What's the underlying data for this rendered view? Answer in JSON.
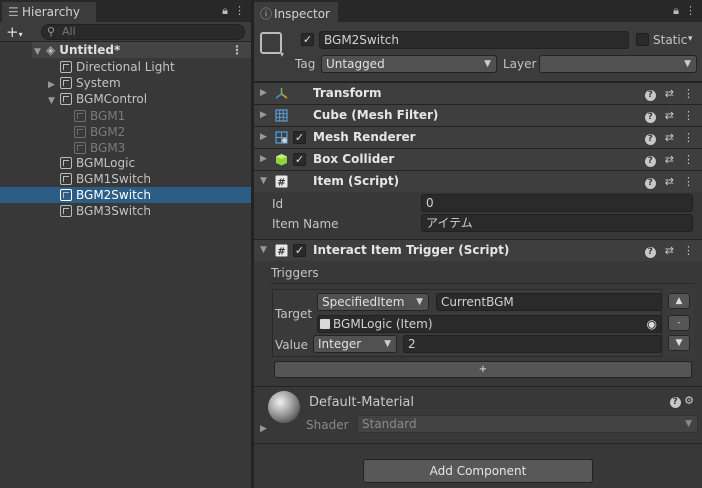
{
  "hierarchy": {
    "tab_title": "Hierarchy",
    "search_placeholder": "All",
    "scene_name": "Untitled*",
    "items": [
      {
        "label": "Directional Light"
      },
      {
        "label": "System"
      },
      {
        "label": "BGMControl"
      },
      {
        "label": "BGM1"
      },
      {
        "label": "BGM2"
      },
      {
        "label": "BGM3"
      },
      {
        "label": "BGMLogic"
      },
      {
        "label": "BGM1Switch"
      },
      {
        "label": "BGM2Switch"
      },
      {
        "label": "BGM3Switch"
      }
    ],
    "selected": "BGM2Switch"
  },
  "inspector": {
    "tab_title": "Inspector",
    "object_name": "BGM2Switch",
    "static_label": "Static",
    "tag_label": "Tag",
    "tag_value": "Untagged",
    "layer_label": "Layer",
    "layer_value": "",
    "components": {
      "transform": "Transform",
      "mesh_filter": "Cube (Mesh Filter)",
      "mesh_renderer": "Mesh Renderer",
      "box_collider": "Box Collider",
      "item_script": "Item (Script)",
      "interact": "Interact Item Trigger (Script)"
    },
    "item_fields": {
      "id_label": "Id",
      "id_value": "0",
      "name_label": "Item Name",
      "name_value": "アイテム"
    },
    "triggers": {
      "header": "Triggers",
      "target_label": "Target",
      "target_mode": "SpecifiedItem",
      "target_name": "CurrentBGM",
      "target_object": "BGMLogic (Item)",
      "value_label": "Value",
      "value_type": "Integer",
      "value": "2",
      "add_symbol": "+",
      "remove_symbol": "-"
    },
    "material": {
      "name": "Default-Material",
      "shader_label": "Shader",
      "shader_value": "Standard"
    },
    "add_component": "Add Component"
  },
  "colors": {
    "selection": "#2c5d87",
    "panel": "#383838",
    "mesh_filter_icon": "#5aa0d8",
    "box_collider_icon": "#8fd43a",
    "transform_icon": "#e0a030"
  }
}
